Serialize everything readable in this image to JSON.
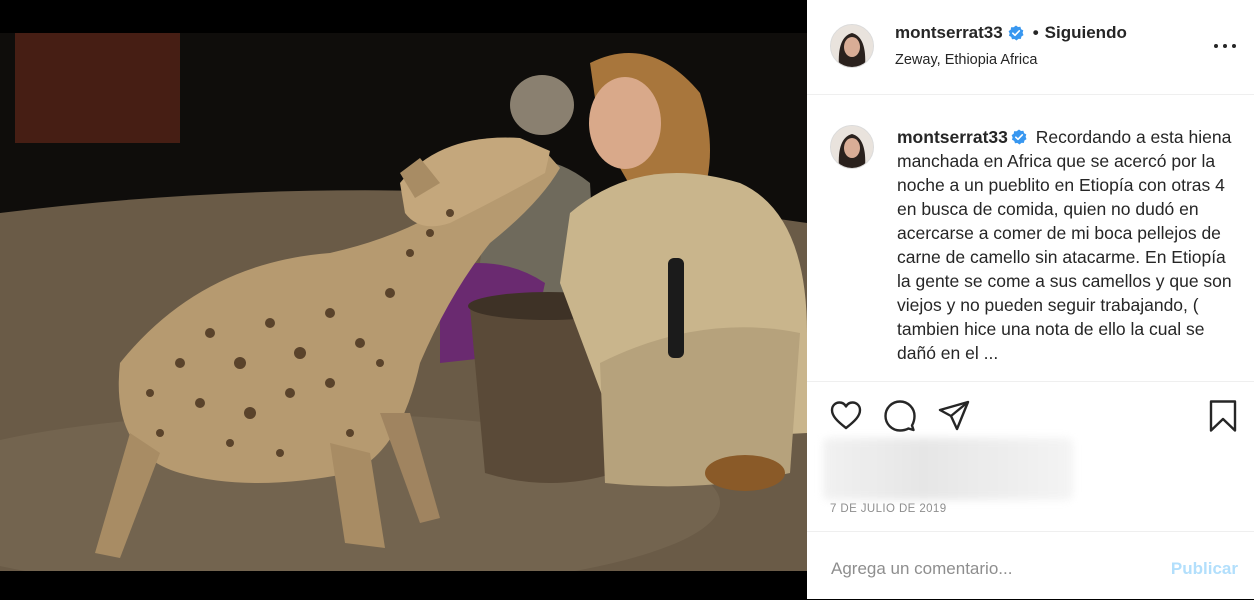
{
  "post": {
    "username": "montserrat33",
    "separator": "•",
    "follow_status": "Siguiendo",
    "location": "Zeway, Ethiopia Africa",
    "caption_user": "montserrat33",
    "caption_text": "Recordando a esta hiena manchada en Africa que se acercó por la noche a un pueblito en Etiopía con otras 4 en busca de comida, quien no dudó en acercarse a comer de mi boca pellejos de carne de camello sin atacarme. En Etiopía la gente se come a sus camellos y que son viejos y no pueden seguir trabajando, ( tambien hice una nota de ello la cual se dañó en el ...",
    "date": "7 DE JULIO DE 2019"
  },
  "icons": {
    "verified": "verified-badge-icon",
    "more": "more-options-icon",
    "like": "heart-icon",
    "comment": "comment-bubble-icon",
    "share": "paper-plane-icon",
    "save": "bookmark-icon"
  },
  "comment": {
    "placeholder": "Agrega un comentario...",
    "publish_label": "Publicar"
  },
  "colors": {
    "verified_blue": "#3897f0",
    "publish_disabled": "#b2dffc",
    "text": "#262626",
    "muted": "#8e8e8e"
  }
}
